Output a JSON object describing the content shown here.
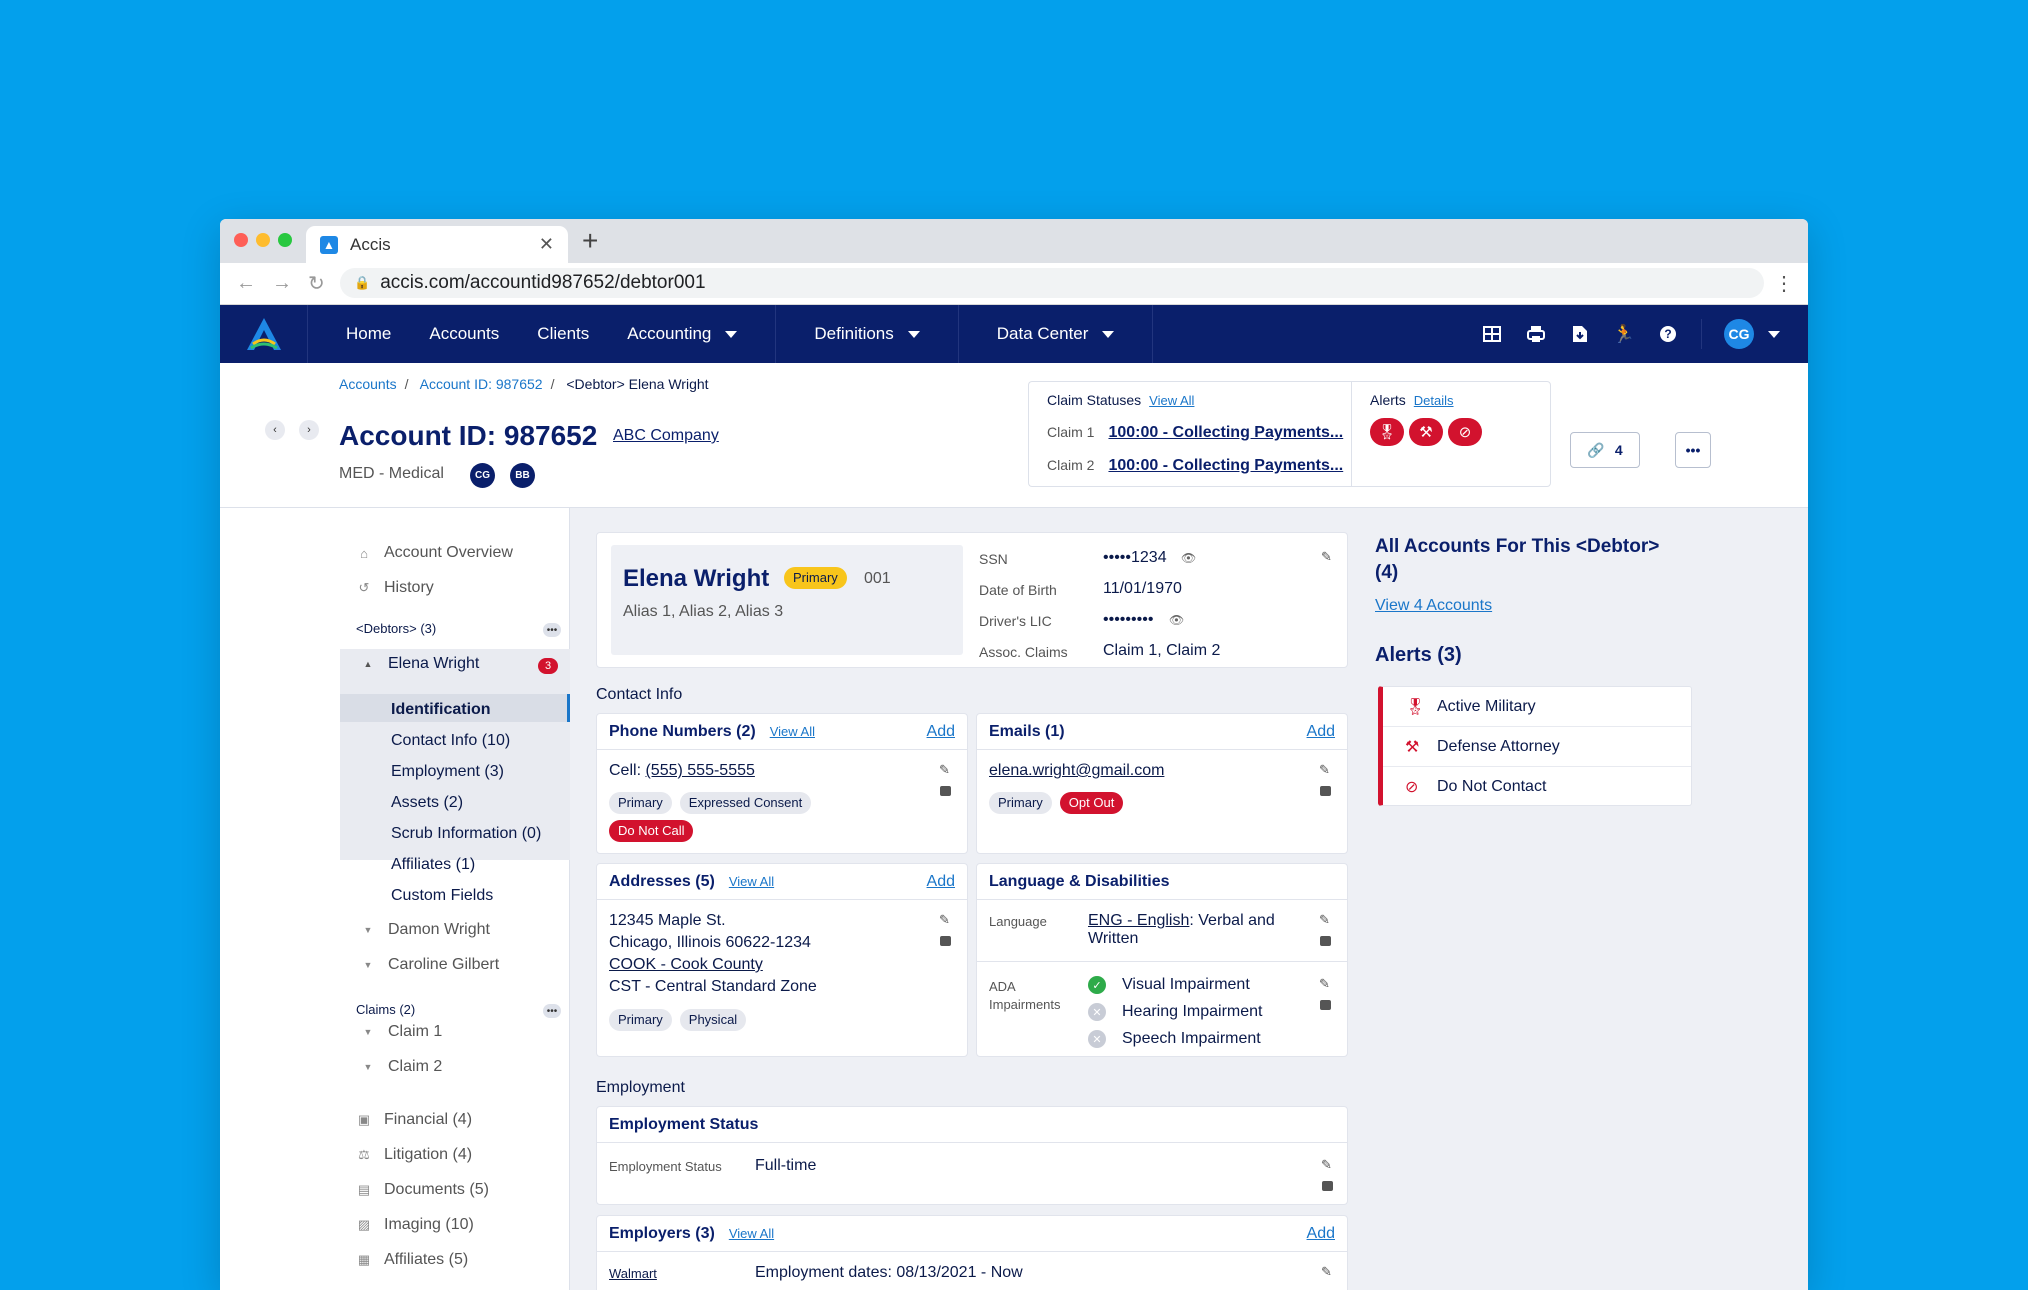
{
  "browser": {
    "tab_title": "Accis",
    "url": "accis.com/accountid987652/debtor001"
  },
  "nav": {
    "items": [
      "Home",
      "Accounts",
      "Clients",
      "Accounting",
      "Definitions",
      "Data Center"
    ],
    "user_initials": "CG"
  },
  "header": {
    "breadcrumb": [
      "Accounts",
      "Account ID: 987652",
      "<Debtor> Elena Wright"
    ],
    "title": "Account ID: 987652",
    "company": "ABC Company",
    "subtitle": "MED - Medical",
    "badges": [
      "CG",
      "BB"
    ],
    "claim_statuses_label": "Claim Statuses",
    "claim_view_all": "View All",
    "claims": [
      {
        "label": "Claim 1",
        "status": "100:00 - Collecting Payments..."
      },
      {
        "label": "Claim 2",
        "status": "100:00 - Collecting Payments..."
      }
    ],
    "alerts_label": "Alerts",
    "alerts_details": "Details",
    "link_count": "4"
  },
  "sidebar": {
    "top": [
      "Account Overview",
      "History"
    ],
    "debtors_label": "<Debtors> (3)",
    "active_debtor": "Elena Wright",
    "active_debtor_count": "3",
    "sub_items": [
      "Identification",
      "Contact Info (10)",
      "Employment (3)",
      "Assets (2)",
      "Scrub Information (0)",
      "Affiliates (1)",
      "Custom Fields"
    ],
    "other_debtors": [
      "Damon Wright",
      "Caroline Gilbert"
    ],
    "claims_label": "Claims (2)",
    "claims": [
      "Claim 1",
      "Claim 2"
    ],
    "bottom": [
      "Financial (4)",
      "Litigation (4)",
      "Documents (5)",
      "Imaging (10)",
      "Affiliates (5)"
    ]
  },
  "debtor": {
    "name": "Elena Wright",
    "tag": "Primary",
    "number": "001",
    "aliases": "Alias 1, Alias 2, Alias 3",
    "fields": [
      {
        "label": "SSN",
        "value": "•••••1234"
      },
      {
        "label": "Date of Birth",
        "value": "11/01/1970"
      },
      {
        "label": "Driver's LIC",
        "value": "•••••••••"
      },
      {
        "label": "Assoc. Claims",
        "value": "Claim 1, Claim 2"
      }
    ]
  },
  "contact": {
    "section": "Contact Info",
    "phones_title": "Phone Numbers (2)",
    "phones_view_all": "View All",
    "add": "Add",
    "phone_label": "Cell:",
    "phone": "(555) 555-5555",
    "phone_tags": [
      "Primary",
      "Expressed Consent"
    ],
    "phone_red_tag": "Do Not Call",
    "emails_title": "Emails (1)",
    "email": "elena.wright@gmail.com",
    "email_tag": "Primary",
    "email_red_tag": "Opt Out",
    "addresses_title": "Addresses (5)",
    "addresses_view_all": "View All",
    "address_lines": [
      "12345 Maple St.",
      "Chicago, Illinois 60622-1234",
      "COOK - Cook County",
      "CST - Central Standard Zone"
    ],
    "address_tags": [
      "Primary",
      "Physical"
    ],
    "lang_title": "Language & Disabilities",
    "language_label": "Language",
    "language_link": "ENG - English",
    "language_rest": ": Verbal and",
    "language_rest2": "Written",
    "ada_label": "ADA",
    "ada_label2": "Impairments",
    "ada_items": [
      "Visual Impairment",
      "Hearing Impairment",
      "Speech Impairment"
    ]
  },
  "employment": {
    "section": "Employment",
    "status_title": "Employment Status",
    "status_label": "Employment Status",
    "status_value": "Full-time",
    "employers_title": "Employers (3)",
    "employers_view_all": "View All",
    "add": "Add",
    "employer": "Walmart",
    "employer_dates": "Employment dates: 08/13/2021 - Now"
  },
  "right": {
    "all_accounts_title": "All Accounts For This <Debtor>",
    "all_accounts_count": "(4)",
    "view_link": "View 4 Accounts",
    "alerts_title": "Alerts (3)",
    "alerts": [
      "Active Military",
      "Defense Attorney",
      "Do Not Contact"
    ]
  },
  "colors": {
    "brand_navy": "#0a1f6b",
    "background": "#03a0ec",
    "alert_red": "#d2122e",
    "primary_yellow": "#f8c51b",
    "link_blue": "#1a76c9"
  }
}
